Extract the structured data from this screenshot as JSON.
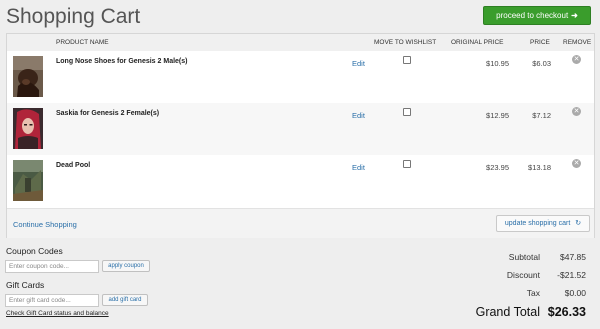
{
  "page": {
    "title": "Shopping Cart"
  },
  "checkout": {
    "label": "proceed to checkout",
    "arrow": "➜"
  },
  "table": {
    "headers": {
      "product": "PRODUCT NAME",
      "wishlist": "MOVE TO WISHLIST",
      "original": "ORIGINAL PRICE",
      "price": "PRICE",
      "remove": "REMOVE"
    },
    "edit_label": "Edit",
    "remove_glyph": "✕",
    "items": [
      {
        "name": "Long Nose Shoes for Genesis 2 Male(s)",
        "original_price": "$10.95",
        "price": "$6.03",
        "wishlist_checked": false
      },
      {
        "name": "Saskia for Genesis 2 Female(s)",
        "original_price": "$12.95",
        "price": "$7.12",
        "wishlist_checked": false
      },
      {
        "name": "Dead Pool",
        "original_price": "$23.95",
        "price": "$13.18",
        "wishlist_checked": false
      }
    ]
  },
  "footer": {
    "continue": "Continue Shopping",
    "update": "update shopping cart",
    "update_icon": "↻"
  },
  "coupon": {
    "label": "Coupon Codes",
    "placeholder": "Enter coupon code...",
    "button": "apply coupon"
  },
  "giftcard": {
    "label": "Gift Cards",
    "placeholder": "Enter gift card code...",
    "button": "add gift card",
    "link": "Check Gift Card status and balance"
  },
  "summary": {
    "subtotal_label": "Subtotal",
    "subtotal": "$47.85",
    "discount_label": "Discount",
    "discount": "-$21.52",
    "tax_label": "Tax",
    "tax": "$0.00",
    "grand_label": "Grand Total",
    "grand": "$26.33"
  },
  "colors": {
    "accent_green": "#3a9d2c",
    "link_blue": "#2a6fa8"
  }
}
